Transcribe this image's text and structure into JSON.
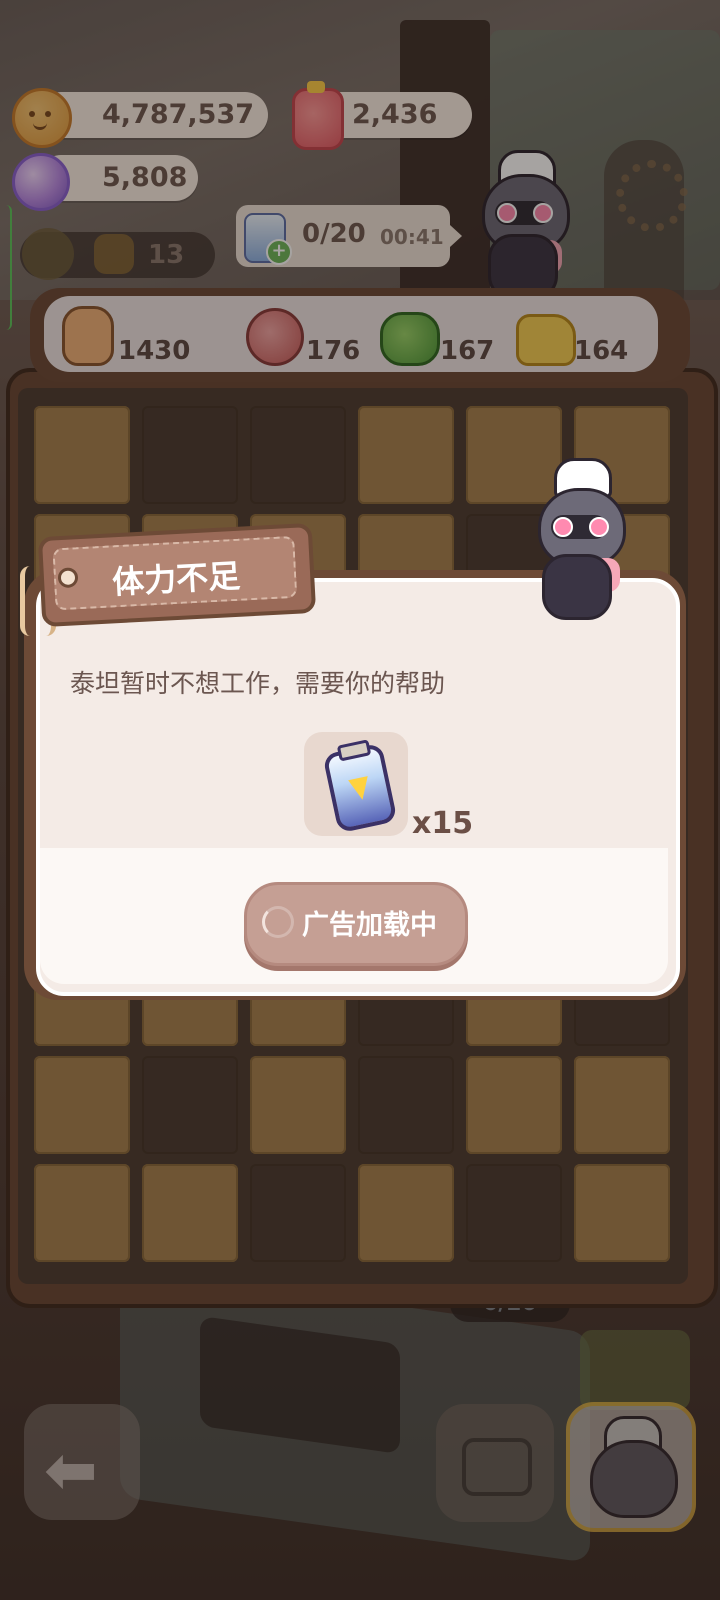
{
  "currencies": {
    "coins": "4,787,537",
    "jam": "2,436",
    "gems": "5,808"
  },
  "secondary_stat": "13",
  "energy_timer": {
    "count": "0/20",
    "time": "00:41"
  },
  "ingredients": [
    {
      "icon": "lamb-leg-icon",
      "count": "1430"
    },
    {
      "icon": "meat-icon",
      "count": "176"
    },
    {
      "icon": "broccoli-icon",
      "count": "167"
    },
    {
      "icon": "cheese-icon",
      "count": "164"
    }
  ],
  "dialog": {
    "title": "体力不足",
    "message": "泰坦暂时不想工作，需要你的帮助",
    "reward_quantity": "x15",
    "ad_button_label": "广告加载中"
  },
  "station_bubble": "0/20",
  "icons": {
    "energy": "battery-icon",
    "back": "back-arrow-icon",
    "oven": "oven-icon",
    "chef": "raccoon-chef-icon"
  }
}
